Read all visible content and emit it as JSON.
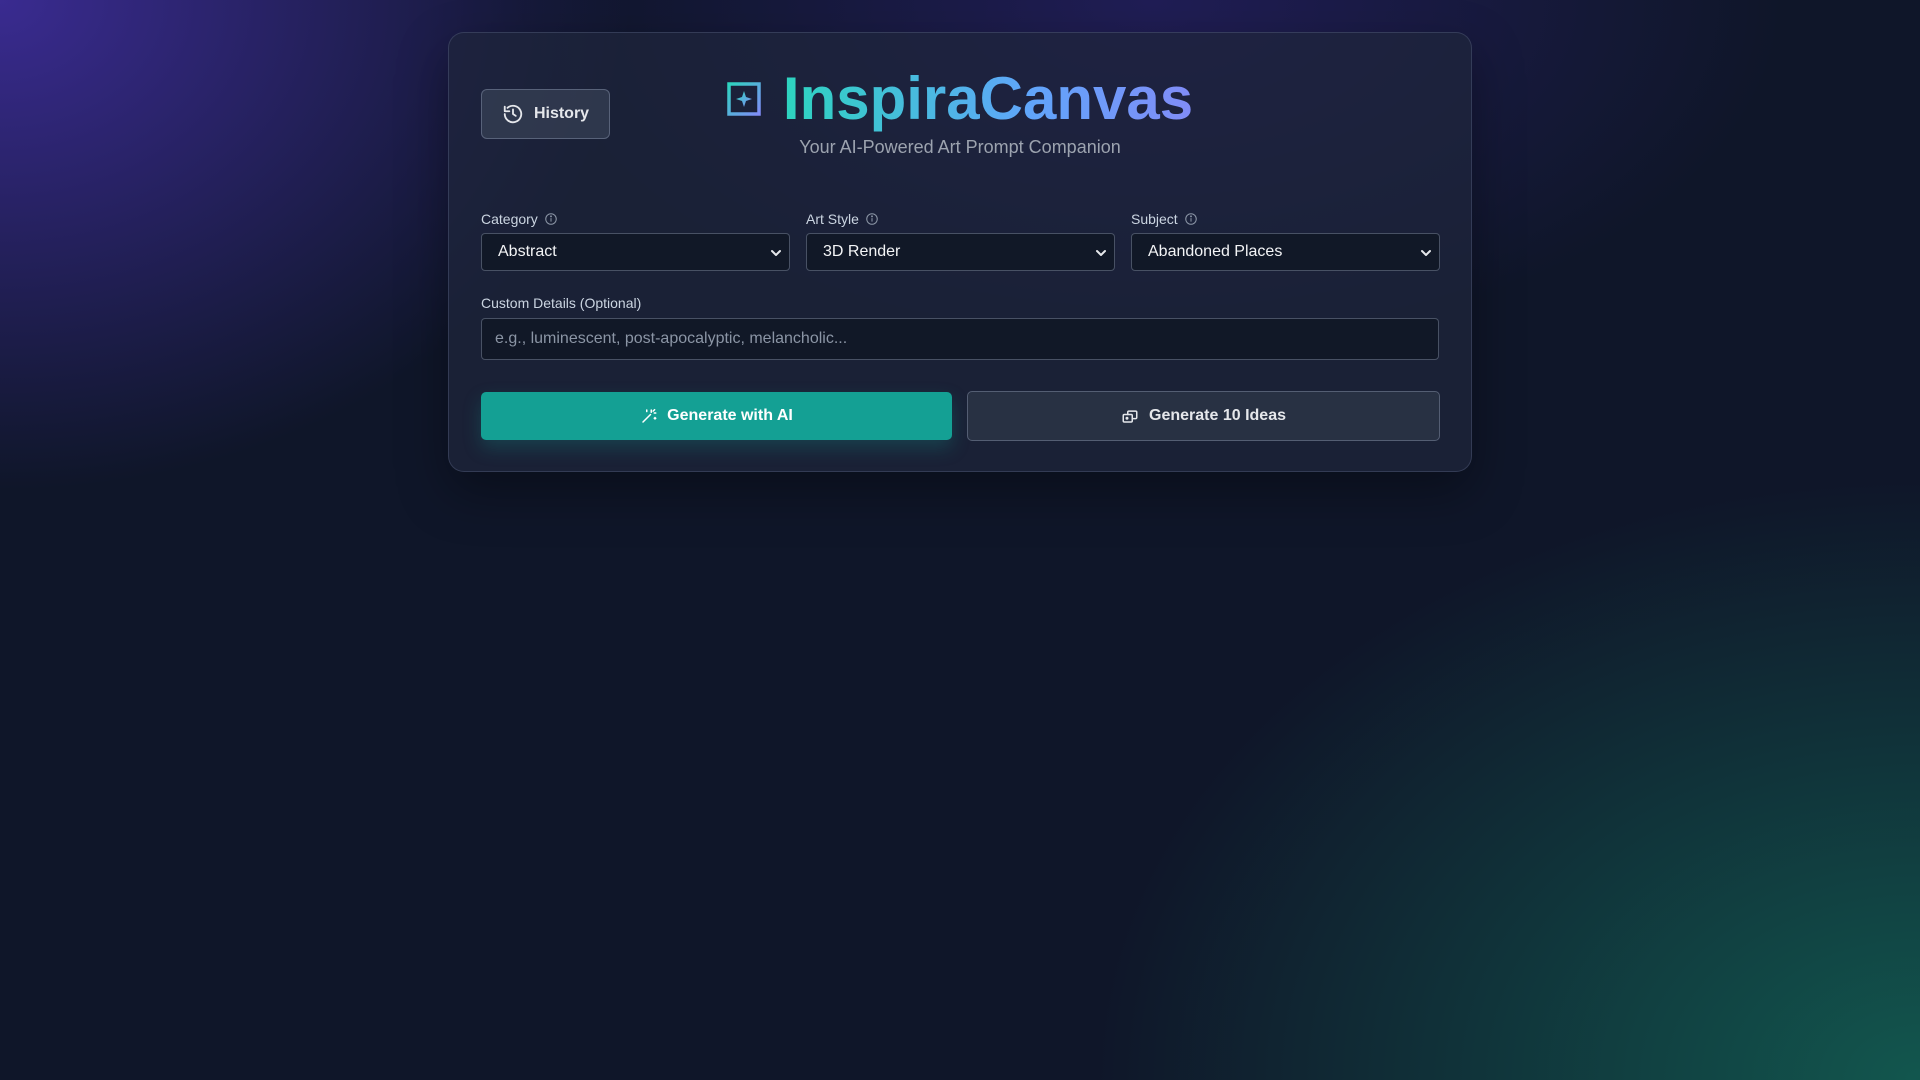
{
  "header": {
    "history_label": "History",
    "history_icon": "history-icon",
    "logo_icon": "sparkle-frame-icon",
    "title": "InspiraCanvas",
    "subtitle": "Your AI-Powered Art Prompt Companion"
  },
  "form": {
    "category": {
      "label": "Category",
      "value": "Abstract",
      "icon": "info-icon"
    },
    "art_style": {
      "label": "Art Style",
      "value": "3D Render",
      "icon": "info-icon"
    },
    "subject": {
      "label": "Subject",
      "value": "Abandoned Places",
      "icon": "info-icon"
    },
    "custom_details": {
      "label": "Custom Details (Optional)",
      "value": "",
      "placeholder": "e.g., luminescent, post-apocalyptic, melancholic..."
    }
  },
  "actions": {
    "generate_ai_label": "Generate with AI",
    "generate_ai_icon": "magic-wand-icon",
    "generate_ideas_label": "Generate 10 Ideas",
    "generate_ideas_icon": "cards-icon"
  },
  "colors": {
    "accent_teal": "#14a094",
    "title_gradient_start": "#2dd4bf",
    "title_gradient_end": "#818cf8"
  }
}
